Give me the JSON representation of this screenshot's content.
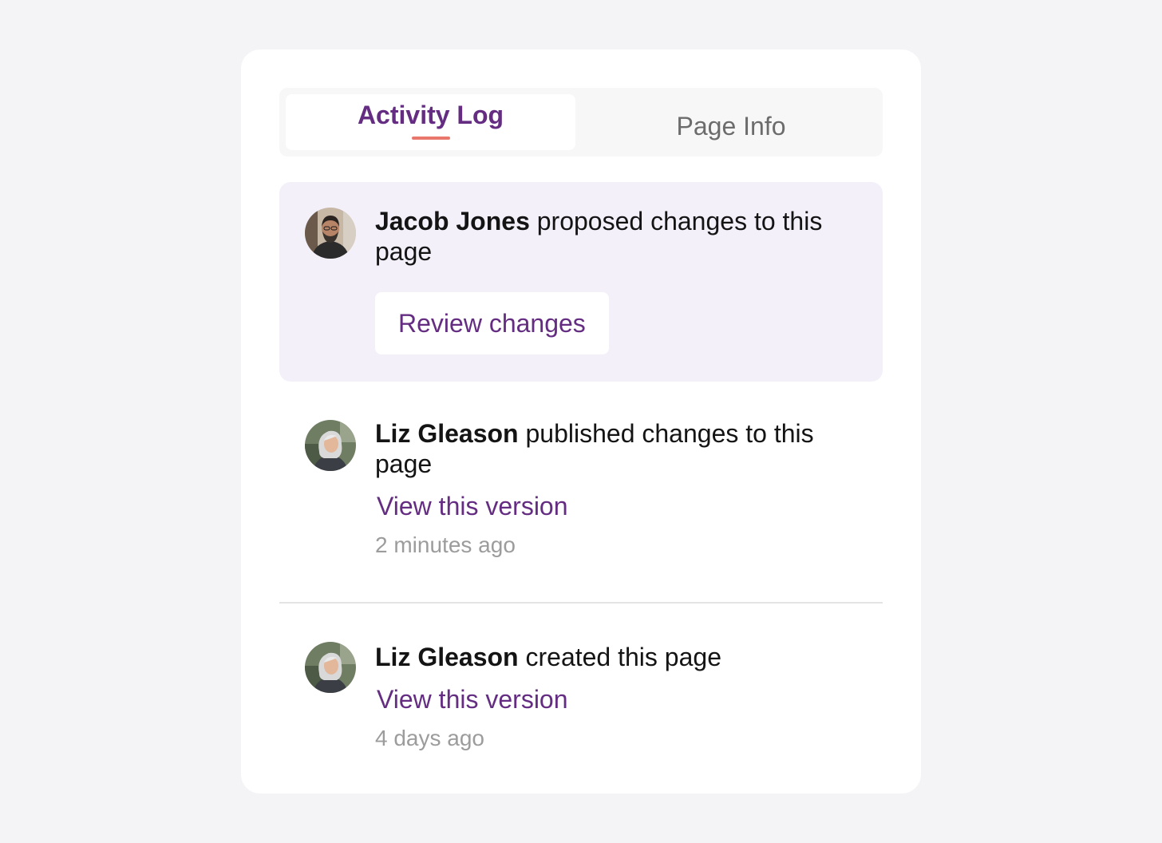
{
  "tabs": {
    "active": "Activity Log",
    "inactive": "Page Info"
  },
  "colors": {
    "accent": "#642d82",
    "tab_underline": "#e9776c",
    "highlight_bg": "#f3f0fa",
    "timestamp": "#9c9c9c"
  },
  "activity": [
    {
      "user": "Jacob Jones",
      "action": " proposed changes to this page",
      "button_label": "Review changes",
      "avatar_icon": "user-avatar-jacob-jones"
    },
    {
      "user": "Liz Gleason",
      "action": " published changes to this page",
      "link_label": "View this version",
      "time": "2 minutes ago",
      "avatar_icon": "user-avatar-liz-gleason"
    },
    {
      "user": "Liz Gleason",
      "action": " created this page",
      "link_label": "View this version",
      "time": "4 days ago",
      "avatar_icon": "user-avatar-liz-gleason"
    }
  ]
}
